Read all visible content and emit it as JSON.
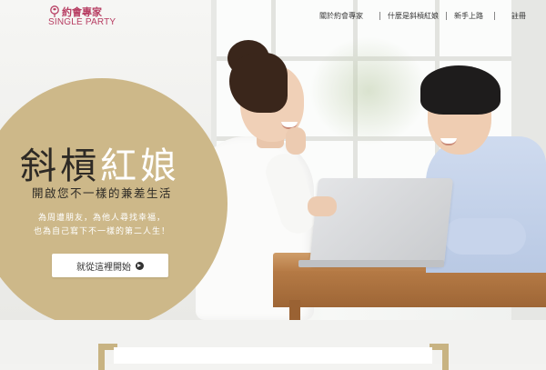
{
  "logo": {
    "name_zh": "約會專家",
    "name_en": "SINGLE PARTY"
  },
  "nav": {
    "items": [
      {
        "label": "關於約會專家"
      },
      {
        "label": "什麼是斜槓紅娘"
      },
      {
        "label": "新手上路"
      },
      {
        "label": "註冊"
      }
    ]
  },
  "hero": {
    "title_part1": "斜槓",
    "title_part2": "紅娘",
    "subtitle": "開啟您不一樣的兼差生活",
    "desc_line1": "為周遭朋友，為他人尋找幸福，",
    "desc_line2": "也為自己寫下不一樣的第二人生！",
    "cta_label": "就從這裡開始"
  },
  "colors": {
    "accent_gold": "#cdb889",
    "brand_pink": "#b73d62",
    "title_dark": "#2e2a25"
  },
  "icons": {
    "logo": "rose-icon",
    "cta": "arrow-right-circle-icon"
  }
}
